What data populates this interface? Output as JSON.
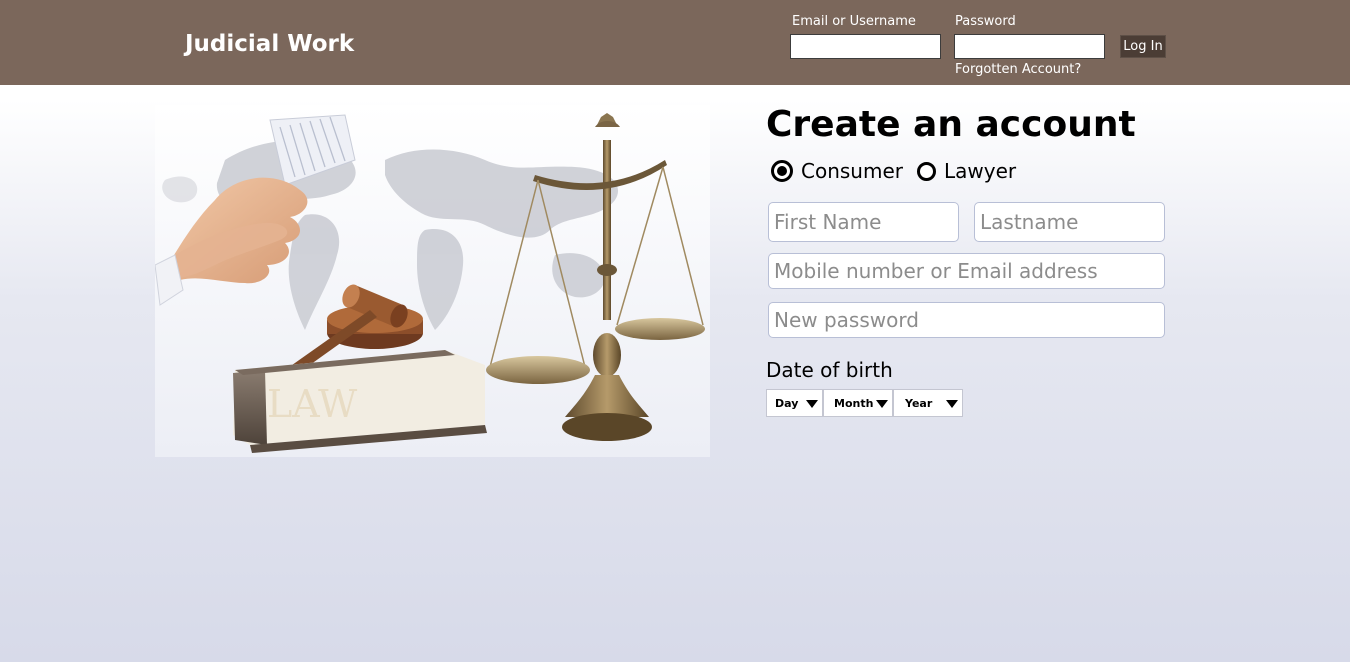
{
  "header": {
    "brand": "Judicial Work",
    "email_label": "Email or Username",
    "password_label": "Password",
    "login_button": "Log In",
    "forgot_link": "Forgotten Account?",
    "email_value": "",
    "password_value": ""
  },
  "hero": {
    "book_text": "LAW"
  },
  "signup": {
    "title": "Create an account",
    "account_types": [
      {
        "label": "Consumer",
        "selected": true
      },
      {
        "label": "Lawyer",
        "selected": false
      }
    ],
    "first_name_placeholder": "First Name",
    "last_name_placeholder": "Lastname",
    "contact_placeholder": "Mobile number or Email address",
    "password_placeholder": "New password",
    "dob_label": "Date of birth",
    "dob_day": "Day",
    "dob_month": "Month",
    "dob_year": "Year"
  },
  "colors": {
    "header_bg": "#7b675b",
    "login_button_bg": "#4b3d35"
  }
}
